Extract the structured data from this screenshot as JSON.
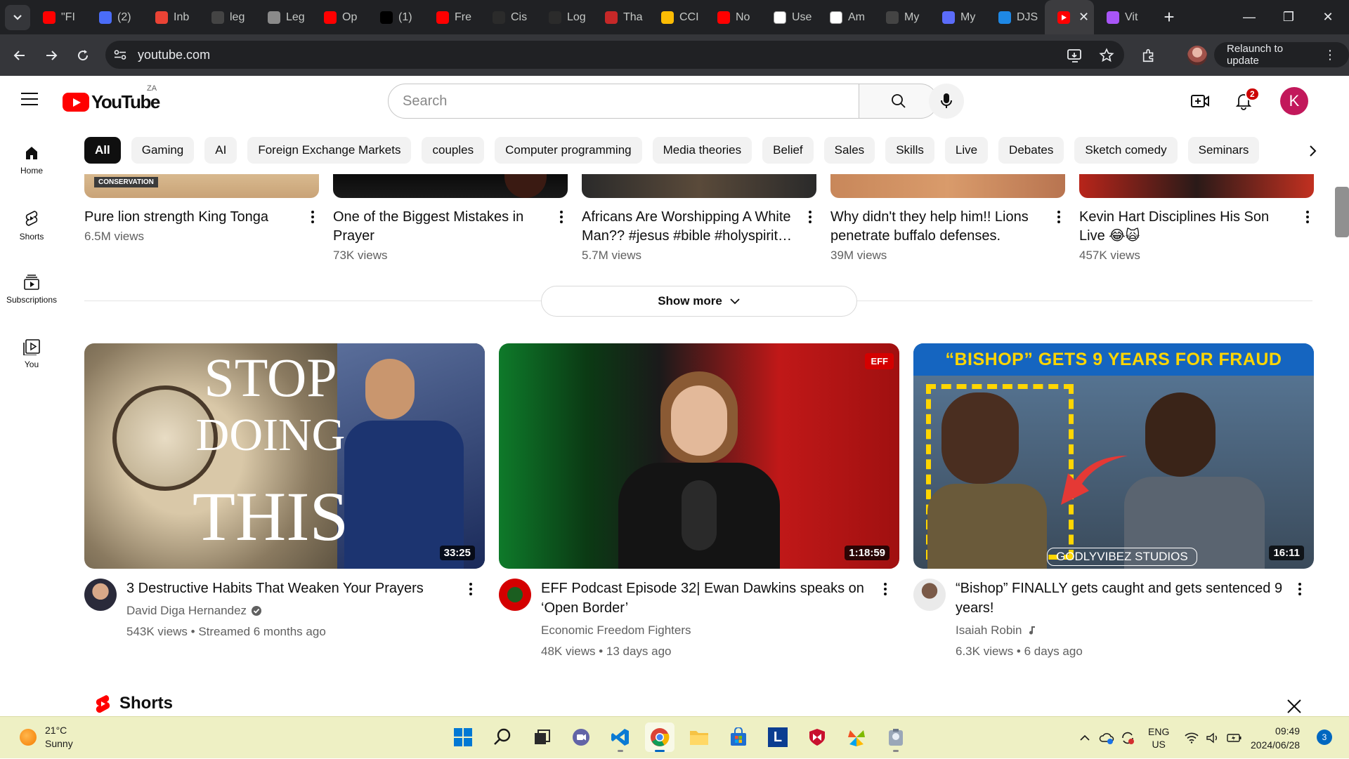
{
  "browser": {
    "tabs": [
      {
        "label": "\"FI",
        "favicon": "youtube-icon",
        "color": "#ff0000"
      },
      {
        "label": "(2)",
        "favicon": "copilot-icon",
        "color": "#4a6cf7"
      },
      {
        "label": "Inb",
        "favicon": "gmail-icon",
        "color": "#ea4335"
      },
      {
        "label": "leg",
        "favicon": "github-icon",
        "color": "#444444"
      },
      {
        "label": "Leg",
        "favicon": "globe-icon",
        "color": "#8a8a8a"
      },
      {
        "label": "Op",
        "favicon": "youtube-icon",
        "color": "#ff0000"
      },
      {
        "label": "(1)",
        "favicon": "x-icon",
        "color": "#000000"
      },
      {
        "label": "Fre",
        "favicon": "youtube-icon",
        "color": "#ff0000"
      },
      {
        "label": "Cis",
        "favicon": "cisco-icon",
        "color": "#2b2b2b"
      },
      {
        "label": "Log",
        "favicon": "login-icon",
        "color": "#2b2b2b"
      },
      {
        "label": "Tha",
        "favicon": "cloud-icon",
        "color": "#c62828"
      },
      {
        "label": "CCI",
        "favicon": "drive-icon",
        "color": "#fbbc04"
      },
      {
        "label": "No",
        "favicon": "youtube-icon",
        "color": "#ff0000"
      },
      {
        "label": "Use",
        "favicon": "chatgpt-icon",
        "color": "#ffffff"
      },
      {
        "label": "Am",
        "favicon": "amazon-icon",
        "color": "#ffffff"
      },
      {
        "label": "My",
        "favicon": "github-icon",
        "color": "#444444"
      },
      {
        "label": "My",
        "favicon": "app-icon",
        "color": "#5b6cf9"
      },
      {
        "label": "DJS",
        "favicon": "onedrive-icon",
        "color": "#1e88e5"
      }
    ],
    "active_tab": {
      "favicon": "youtube-icon",
      "color": "#ff0000"
    },
    "after_tabs": [
      {
        "label": "Vit",
        "favicon": "vite-icon",
        "color": "#a855f7"
      }
    ],
    "url": "youtube.com",
    "relaunch_label": "Relaunch to update"
  },
  "youtube": {
    "country_code": "ZA",
    "logo_text": "YouTube",
    "search_placeholder": "Search",
    "notification_count": "2",
    "avatar_letter": "K",
    "chips": [
      "All",
      "Gaming",
      "AI",
      "Foreign Exchange Markets",
      "couples",
      "Computer programming",
      "Media theories",
      "Belief",
      "Sales",
      "Skills",
      "Live",
      "Debates",
      "Sketch comedy",
      "Seminars"
    ],
    "guide": [
      {
        "label": "Home",
        "icon": "home-icon"
      },
      {
        "label": "Shorts",
        "icon": "shorts-icon"
      },
      {
        "label": "Subscriptions",
        "icon": "subscriptions-icon"
      },
      {
        "label": "You",
        "icon": "you-icon"
      }
    ],
    "row1": [
      {
        "title": "Pure lion strength King Tonga",
        "views": "6.5M views",
        "badge": "CONSERVATION"
      },
      {
        "title": "One of the Biggest Mistakes in Prayer",
        "views": "73K views"
      },
      {
        "title": "Africans Are Worshipping A White Man?? #jesus #bible #holyspirit…",
        "views": "5.7M views"
      },
      {
        "title": "Why didn't they help him!! Lions penetrate buffalo defenses.",
        "views": "39M views"
      },
      {
        "title": "Kevin Hart Disciplines His Son Live 😂🙀",
        "views": "457K views"
      }
    ],
    "show_more": "Show more",
    "videos": [
      {
        "title": "3 Destructive Habits That Weaken Your Prayers",
        "channel": "David Diga Hernandez",
        "verified": true,
        "meta": "543K views • Streamed 6 months ago",
        "duration": "33:25",
        "thumb_text": [
          "STOP",
          "DOING",
          "THIS"
        ]
      },
      {
        "title": "EFF Podcast Episode 32| Ewan Dawkins speaks on ‘Open Border’",
        "channel": "Economic Freedom Fighters",
        "verified": false,
        "meta": "48K views • 13 days ago",
        "duration": "1:18:59",
        "thumb_text": [
          "EFF"
        ]
      },
      {
        "title": "“Bishop” FINALLY gets caught and gets sentenced 9 years!",
        "channel": "Isaiah Robin",
        "verified": false,
        "music_note": true,
        "meta": "6.3K views • 6 days ago",
        "duration": "16:11",
        "thumb_text": [
          "“BISHOP” GETS 9 YEARS FOR FRAUD",
          "GODLYVIBEZ STUDIOS"
        ]
      }
    ],
    "shorts_label": "Shorts"
  },
  "taskbar": {
    "weather_temp": "21°C",
    "weather_desc": "Sunny",
    "lang_top": "ENG",
    "lang_bottom": "US",
    "time": "09:49",
    "date": "2024/06/28",
    "notification_count": "3"
  }
}
